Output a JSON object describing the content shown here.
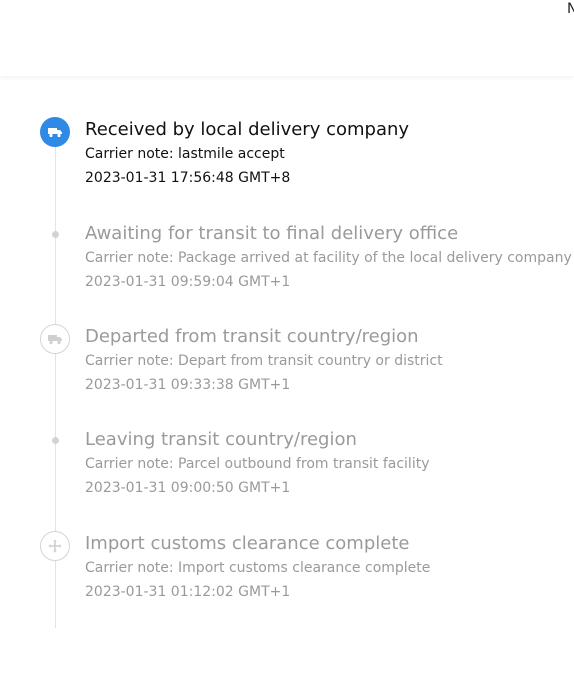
{
  "header": {
    "cut_text": "N"
  },
  "events": [
    {
      "title": "Received by local delivery company",
      "note": "Carrier note: lastmile accept",
      "time": "2023-01-31 17:56:48 GMT+8",
      "icon": "truck-icon",
      "state": "active"
    },
    {
      "title": "Awaiting for transit to final delivery office",
      "note": "Carrier note: Package arrived at facility of the local delivery company",
      "time": "2023-01-31 09:59:04 GMT+1",
      "icon": "dot-icon",
      "state": "past"
    },
    {
      "title": "Departed from transit country/region",
      "note": "Carrier note: Depart from transit country or district",
      "time": "2023-01-31 09:33:38 GMT+1",
      "icon": "truck-icon",
      "state": "past"
    },
    {
      "title": "Leaving transit country/region",
      "note": "Carrier note: Parcel outbound from transit facility",
      "time": "2023-01-31 09:00:50 GMT+1",
      "icon": "dot-icon",
      "state": "past"
    },
    {
      "title": "Import customs clearance complete",
      "note": "Carrier note: Import customs clearance complete",
      "time": "2023-01-31 01:12:02 GMT+1",
      "icon": "customs-icon",
      "state": "past"
    }
  ],
  "colors": {
    "accent": "#2f8ae5",
    "inactive_text": "#9a9a9a",
    "rail": "#e3e3e3"
  }
}
